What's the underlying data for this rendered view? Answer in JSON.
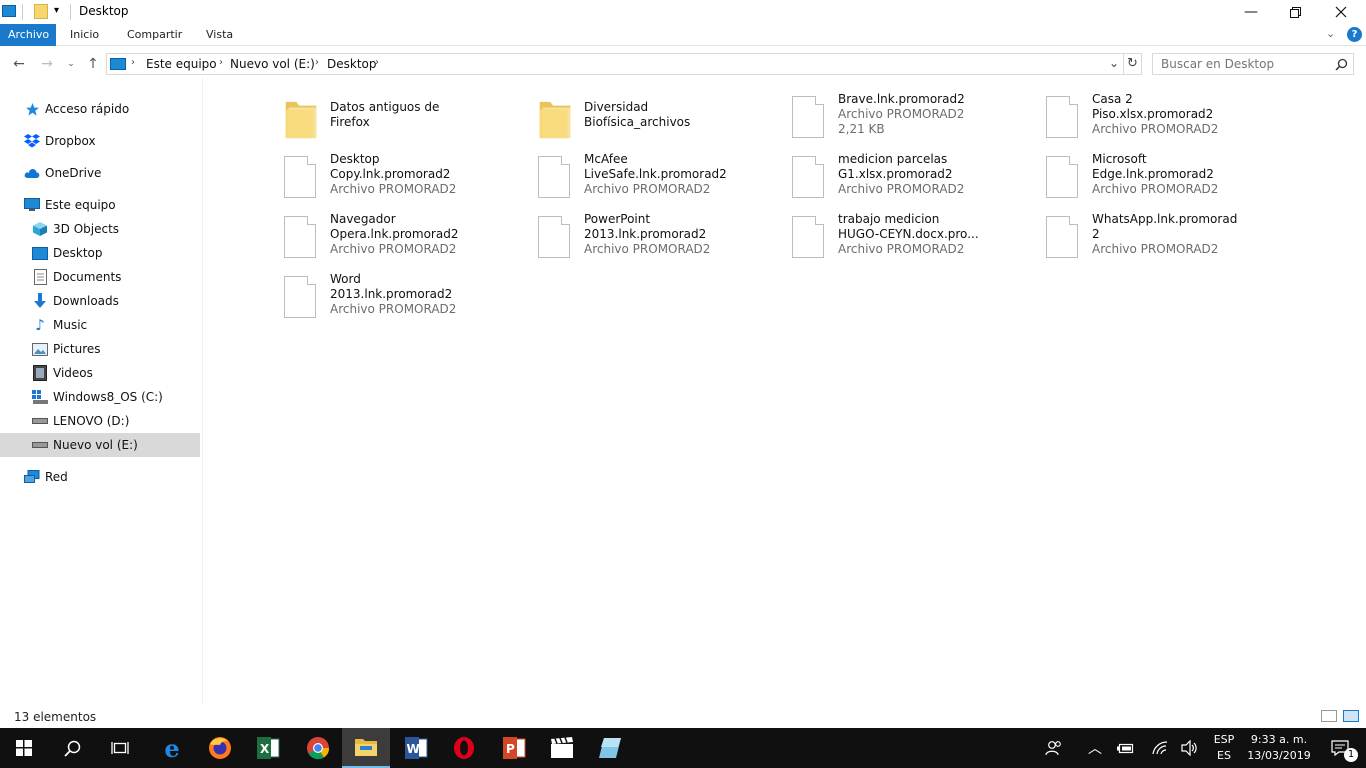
{
  "window": {
    "title": "Desktop",
    "minimize_icon": "minimize-icon",
    "maximize_icon": "restore-icon",
    "close_icon": "close-icon"
  },
  "ribbon": {
    "tabs": [
      "Archivo",
      "Inicio",
      "Compartir",
      "Vista"
    ],
    "active_tab": "Archivo",
    "accent": "#1979ca"
  },
  "address": {
    "crumbs": [
      "Este equipo",
      "Nuevo vol (E:)",
      "Desktop"
    ]
  },
  "search": {
    "placeholder": "Buscar en Desktop"
  },
  "sidebar": {
    "items": [
      {
        "label": "Acceso rápido",
        "icon": "star-icon"
      },
      {
        "label": "Dropbox",
        "icon": "dropbox-icon"
      },
      {
        "label": "OneDrive",
        "icon": "cloud-icon"
      },
      {
        "label": "Este equipo",
        "icon": "computer-icon"
      },
      {
        "label": "3D Objects",
        "icon": "cube-icon"
      },
      {
        "label": "Desktop",
        "icon": "desktop-icon"
      },
      {
        "label": "Documents",
        "icon": "document-icon"
      },
      {
        "label": "Downloads",
        "icon": "download-icon"
      },
      {
        "label": "Music",
        "icon": "music-icon"
      },
      {
        "label": "Pictures",
        "icon": "pictures-icon"
      },
      {
        "label": "Videos",
        "icon": "video-icon"
      },
      {
        "label": "Windows8_OS (C:)",
        "icon": "windows-drive-icon"
      },
      {
        "label": "LENOVO (D:)",
        "icon": "drive-icon"
      },
      {
        "label": "Nuevo vol (E:)",
        "icon": "drive-icon"
      },
      {
        "label": "Red",
        "icon": "network-icon"
      }
    ],
    "selected": "Nuevo vol (E:)"
  },
  "files": [
    {
      "line1": "Datos antiguos de",
      "line2": "Firefox",
      "line3": "",
      "type": "folder"
    },
    {
      "line1": "Diversidad",
      "line2": "Biofísica_archivos",
      "line3": "",
      "type": "folder"
    },
    {
      "line1": "Brave.lnk.promorad2",
      "line2": "Archivo PROMORAD2",
      "line3": "2,21 KB",
      "type": "file"
    },
    {
      "line1": "Casa 2",
      "line2": "Piso.xlsx.promorad2",
      "line3": "Archivo PROMORAD2",
      "type": "file"
    },
    {
      "line1": "Desktop",
      "line2": "Copy.lnk.promorad2",
      "line3": "Archivo PROMORAD2",
      "type": "file"
    },
    {
      "line1": "McAfee",
      "line2": "LiveSafe.lnk.promorad2",
      "line3": "Archivo PROMORAD2",
      "type": "file"
    },
    {
      "line1": "medicion parcelas",
      "line2": "G1.xlsx.promorad2",
      "line3": "Archivo PROMORAD2",
      "type": "file"
    },
    {
      "line1": "Microsoft",
      "line2": "Edge.lnk.promorad2",
      "line3": "Archivo PROMORAD2",
      "type": "file"
    },
    {
      "line1": "Navegador",
      "line2": "Opera.lnk.promorad2",
      "line3": "Archivo PROMORAD2",
      "type": "file"
    },
    {
      "line1": "PowerPoint",
      "line2": "2013.lnk.promorad2",
      "line3": "Archivo PROMORAD2",
      "type": "file"
    },
    {
      "line1": "trabajo medicion",
      "line2": "HUGO-CEYN.docx.pro...",
      "line3": "Archivo PROMORAD2",
      "type": "file"
    },
    {
      "line1": "WhatsApp.lnk.promorad",
      "line2": "2",
      "line3": "Archivo PROMORAD2",
      "type": "file"
    },
    {
      "line1": "Word",
      "line2": "2013.lnk.promorad2",
      "line3": "Archivo PROMORAD2",
      "type": "file"
    }
  ],
  "status": {
    "count": "13 elementos"
  },
  "taskbar": {
    "apps": [
      "start-icon",
      "search-icon",
      "task-view-icon",
      "edge-icon",
      "firefox-icon",
      "excel-icon",
      "chrome-icon",
      "file-explorer-icon",
      "word-icon",
      "opera-icon",
      "powerpoint-icon",
      "movie-maker-icon",
      "app-icon"
    ],
    "lang_top": "ESP",
    "lang_bottom": "ES",
    "time": "9:33 a. m.",
    "date": "13/03/2019",
    "notifications": "1"
  }
}
